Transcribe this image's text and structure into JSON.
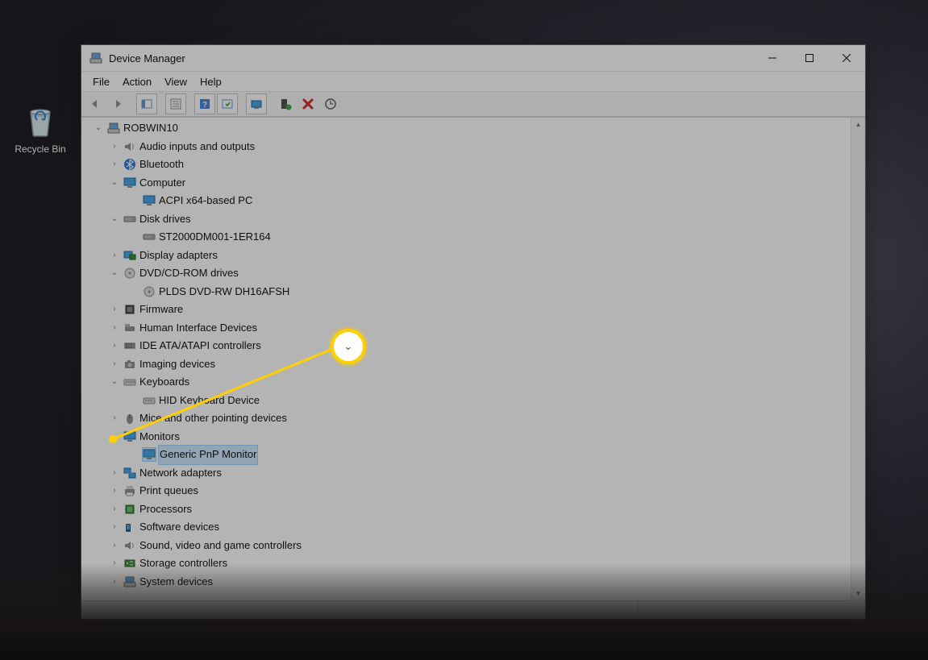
{
  "desktop": {
    "recycle_bin": "Recycle Bin"
  },
  "window": {
    "title": "Device Manager",
    "menus": {
      "file": "File",
      "action": "Action",
      "view": "View",
      "help": "Help"
    }
  },
  "tree": {
    "root": "ROBWIN10",
    "audio": "Audio inputs and outputs",
    "bluetooth": "Bluetooth",
    "computer": "Computer",
    "computer_child": "ACPI x64-based PC",
    "disk": "Disk drives",
    "disk_child": "ST2000DM001-1ER164",
    "display": "Display adapters",
    "dvd": "DVD/CD-ROM drives",
    "dvd_child": "PLDS DVD-RW DH16AFSH",
    "firmware": "Firmware",
    "hid": "Human Interface Devices",
    "ide": "IDE ATA/ATAPI controllers",
    "imaging": "Imaging devices",
    "keyboards": "Keyboards",
    "keyboards_child": "HID Keyboard Device",
    "mice": "Mice and other pointing devices",
    "monitors": "Monitors",
    "monitors_child": "Generic PnP Monitor",
    "network": "Network adapters",
    "print": "Print queues",
    "processors": "Processors",
    "software": "Software devices",
    "sound": "Sound, video and game controllers",
    "storage": "Storage controllers",
    "system": "System devices"
  },
  "icons": {
    "computer_color": "#2e8bd8",
    "highlight": "#ffcf00"
  }
}
